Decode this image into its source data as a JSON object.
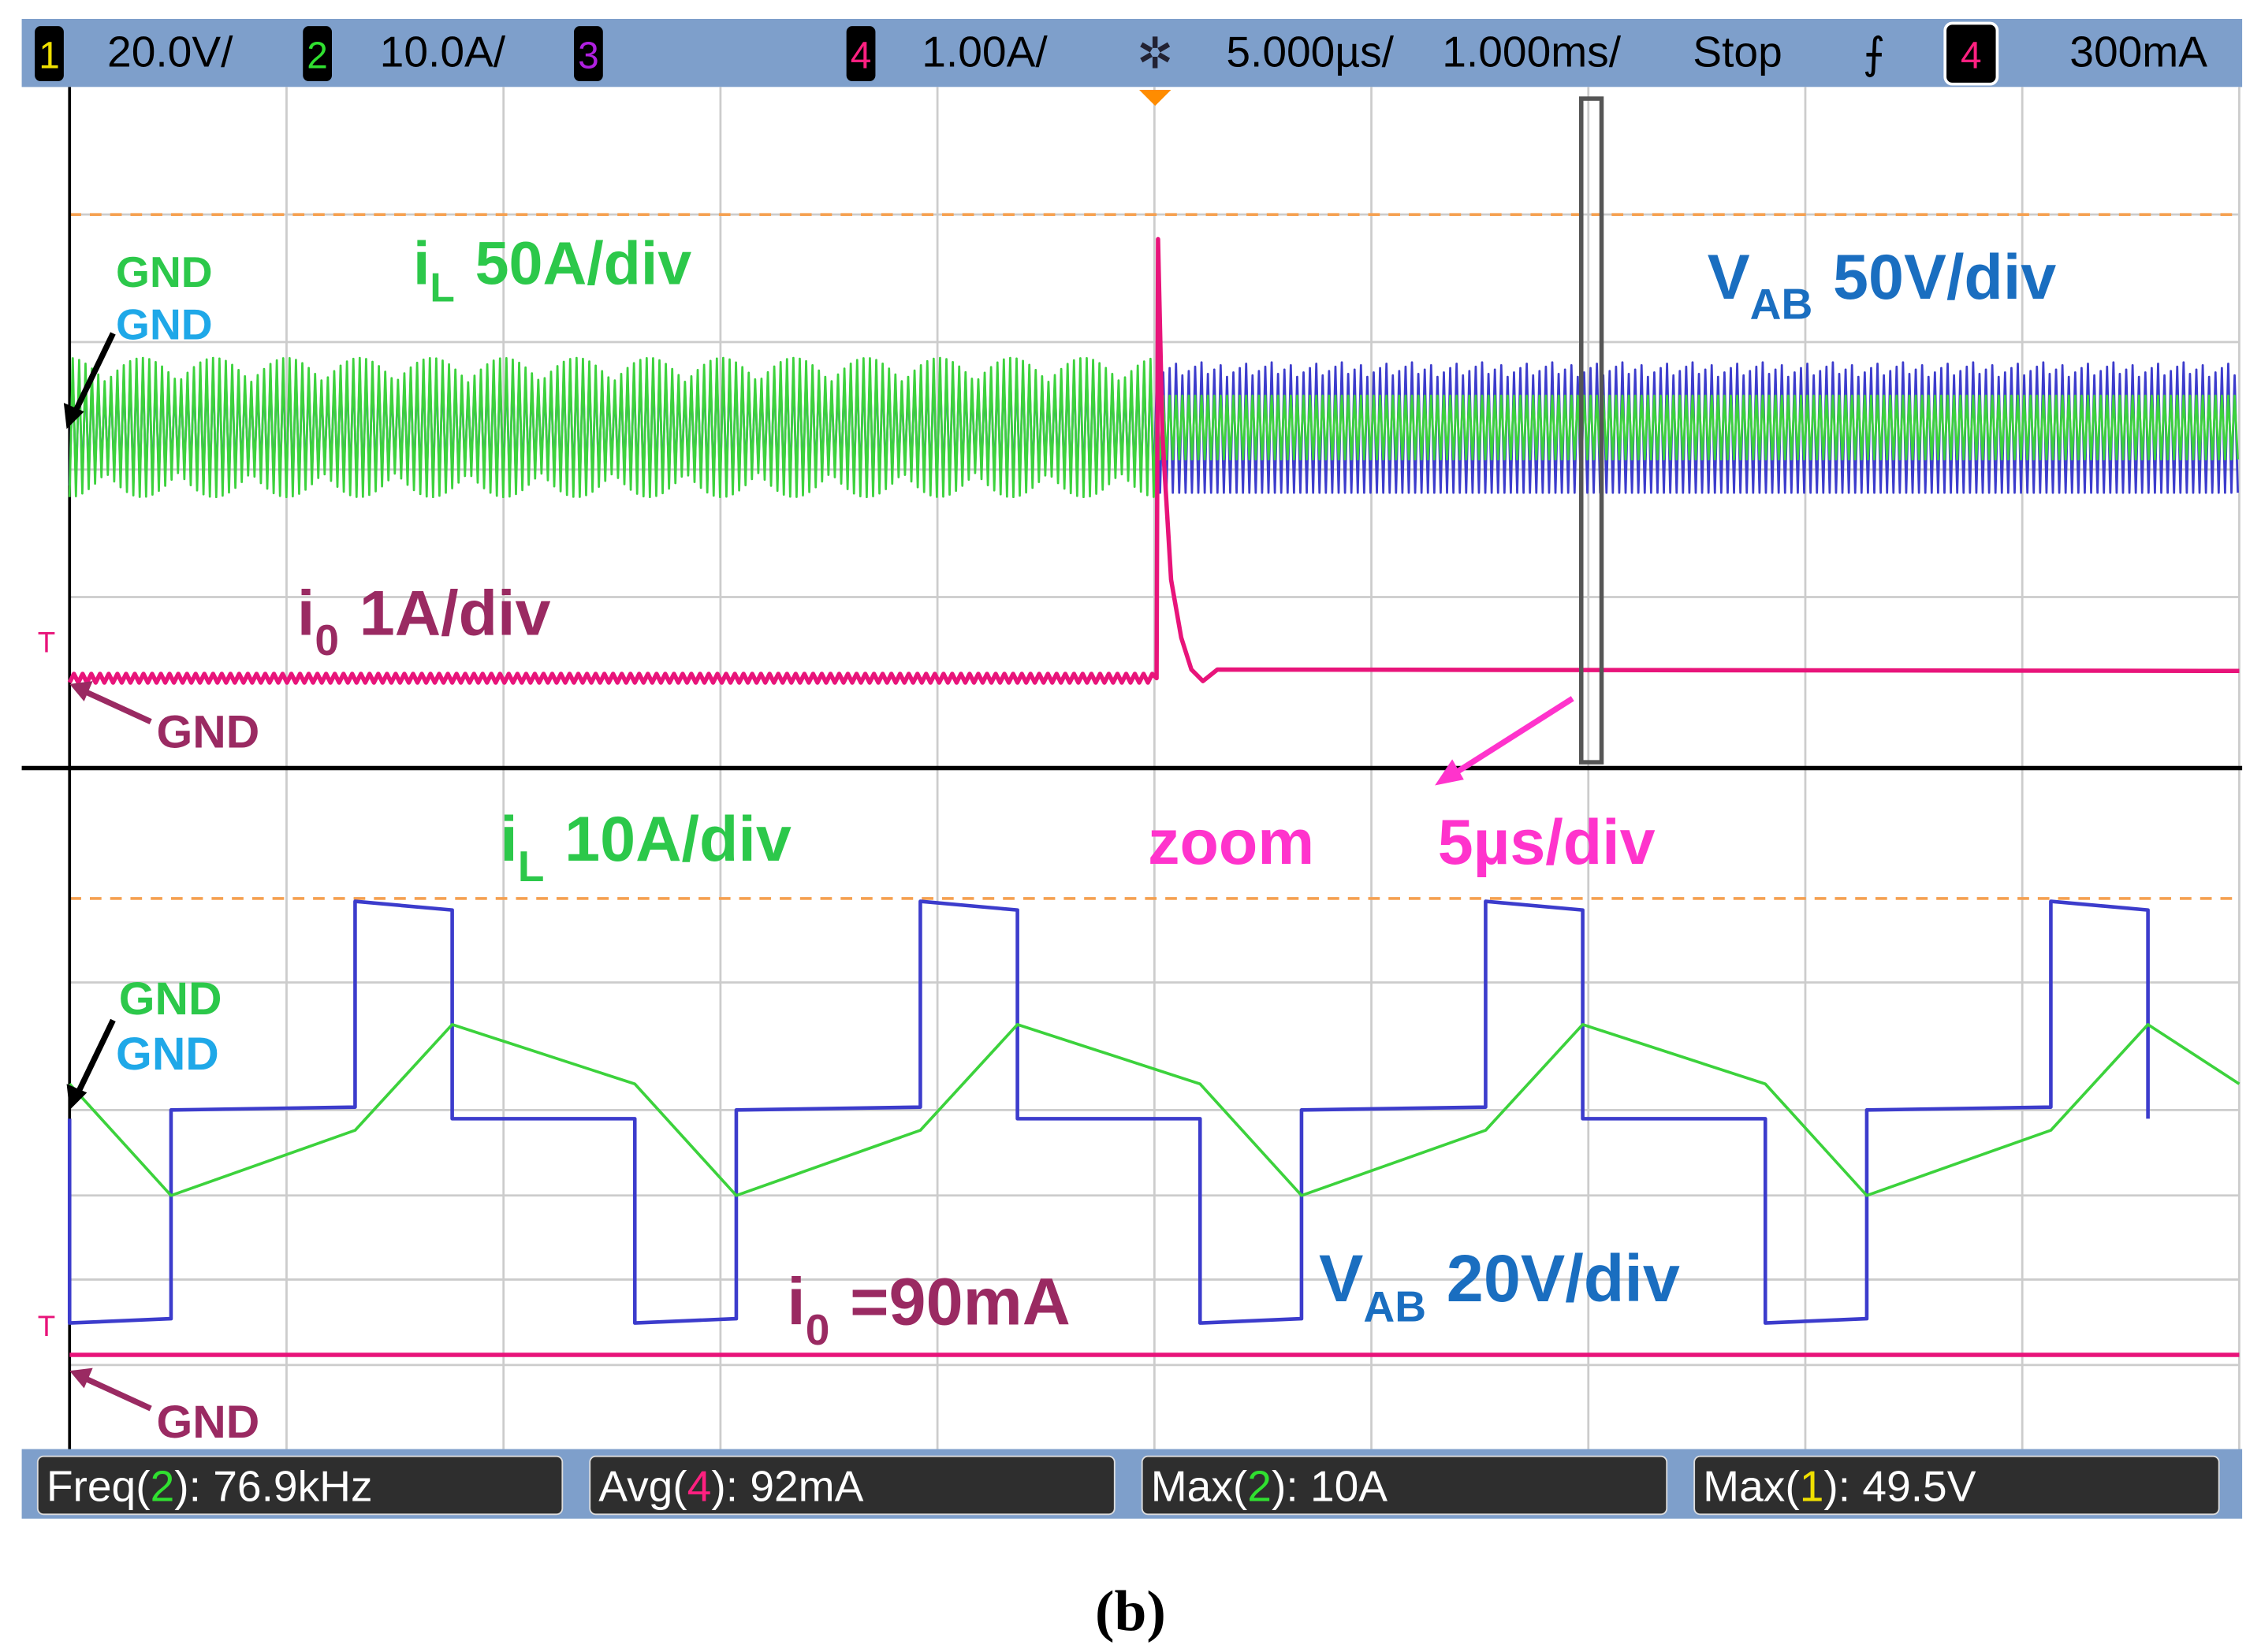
{
  "chart_data": {
    "type": "line",
    "title": "Oscilloscope capture (b)",
    "caption_open": "(",
    "caption_letter": "b",
    "caption_close": ")",
    "top_bar": {
      "ch1": {
        "num": "1",
        "scale": "20.0V/",
        "color": "#f0e000"
      },
      "ch2": {
        "num": "2",
        "scale": "10.0A/",
        "color": "#30e030"
      },
      "ch3": {
        "num": "3",
        "scale": "",
        "color": "#b020e0"
      },
      "ch4": {
        "num": "4",
        "scale": "1.00A/",
        "color": "#ff2080"
      },
      "time_div": "5.000µs/",
      "delay": "1.000ms/",
      "run_state": "Stop",
      "trig_source": "4",
      "trig_level": "300mA"
    },
    "upper_annotations": {
      "gnd_green": "GND",
      "gnd_blue": "GND",
      "il_label": "i",
      "il_sub": "L",
      "il_scale": "50A/div",
      "vab_label": "V",
      "vab_sub": "AB",
      "vab_scale": "50V/div",
      "i0_label": "i",
      "i0_sub": "0",
      "i0_scale": "1A/div",
      "gnd_i0": "GND",
      "trig_marker": "T"
    },
    "lower_annotations": {
      "il_label": "i",
      "il_sub": "L",
      "il_scale": "10A/div",
      "zoom": "zoom",
      "zoom_scale": "5µs/div",
      "gnd_green": "GND",
      "gnd_blue": "GND",
      "vab_label": "V",
      "vab_sub": "AB",
      "vab_scale": "20V/div",
      "i0_label": "i",
      "i0_sub": "0",
      "i0_value": "=90mA",
      "gnd_i0": "GND",
      "trig_marker": "T"
    },
    "measurements": [
      {
        "name": "Freq(",
        "ch": "2",
        "rest": "): 76.9kHz",
        "color": "#30e030"
      },
      {
        "name": "Avg(",
        "ch": "4",
        "rest": "): 92mA",
        "color": "#ff2080"
      },
      {
        "name": "Max(",
        "ch": "2",
        "rest": "): 10A",
        "color": "#30e030"
      },
      {
        "name": "Max(",
        "ch": "1",
        "rest": "): 49.5V",
        "color": "#f0e000"
      }
    ],
    "series": [
      {
        "name": "i_L",
        "color": "#3cd23c"
      },
      {
        "name": "V_AB",
        "color": "#3c3ccc"
      },
      {
        "name": "i_0",
        "color": "#e8147a"
      }
    ],
    "grid": {
      "x_divisions": 10,
      "on": true
    }
  }
}
